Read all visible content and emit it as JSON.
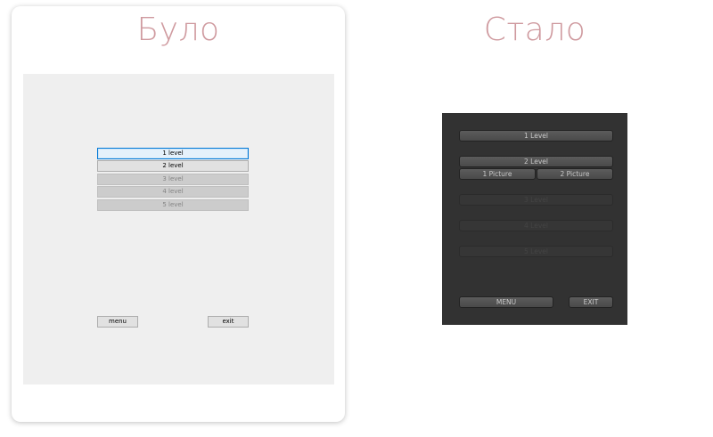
{
  "headings": {
    "before": "Було",
    "after": "Стало"
  },
  "old_window": {
    "levels": [
      "1 level",
      "2 level",
      "3 level",
      "4 level",
      "5 level"
    ],
    "menu_label": "menu",
    "exit_label": "exit"
  },
  "new_window": {
    "level1": "1 Level",
    "level2": "2 Level",
    "picture1": "1 Picture",
    "picture2": "2 Picture",
    "level3": "3 Level",
    "level4": "4 Level",
    "level5": "5 Level",
    "menu_label": "MENU",
    "exit_label": "EXIT"
  },
  "colors": {
    "heading": "#cf9a9f",
    "old_background": "#efefef",
    "new_background": "#323232",
    "focus_border": "#0078d7"
  }
}
